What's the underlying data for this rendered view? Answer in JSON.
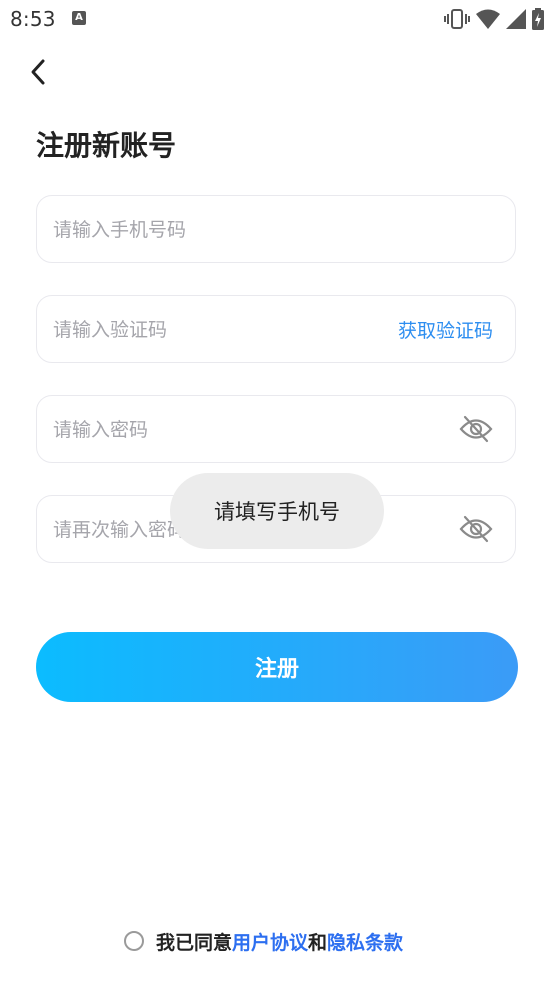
{
  "status_bar": {
    "time": "8:53",
    "notification_letter": "A",
    "icons": [
      "vibrate-icon",
      "wifi-icon",
      "signal-icon",
      "battery-charging-icon"
    ]
  },
  "header": {
    "title": "注册新账号",
    "back_icon": "chevron-left-icon"
  },
  "form": {
    "phone_placeholder": "请输入手机号码",
    "code_placeholder": "请输入验证码",
    "get_code_label": "获取验证码",
    "password_placeholder": "请输入密码",
    "confirm_password_placeholder": "请再次输入密码",
    "password_toggle_icon": "eye-slash-icon",
    "submit_label": "注册"
  },
  "toast": {
    "message": "请填写手机号"
  },
  "agreement": {
    "prefix": "我已同意",
    "user_agreement": "用户协议",
    "conjunction": "和",
    "privacy_policy": "隐私条款"
  },
  "colors": {
    "accent": "#2d8ef0",
    "button_gradient_start": "#0bbcff",
    "button_gradient_end": "#3b9bf7",
    "link": "#2d6ff0"
  }
}
